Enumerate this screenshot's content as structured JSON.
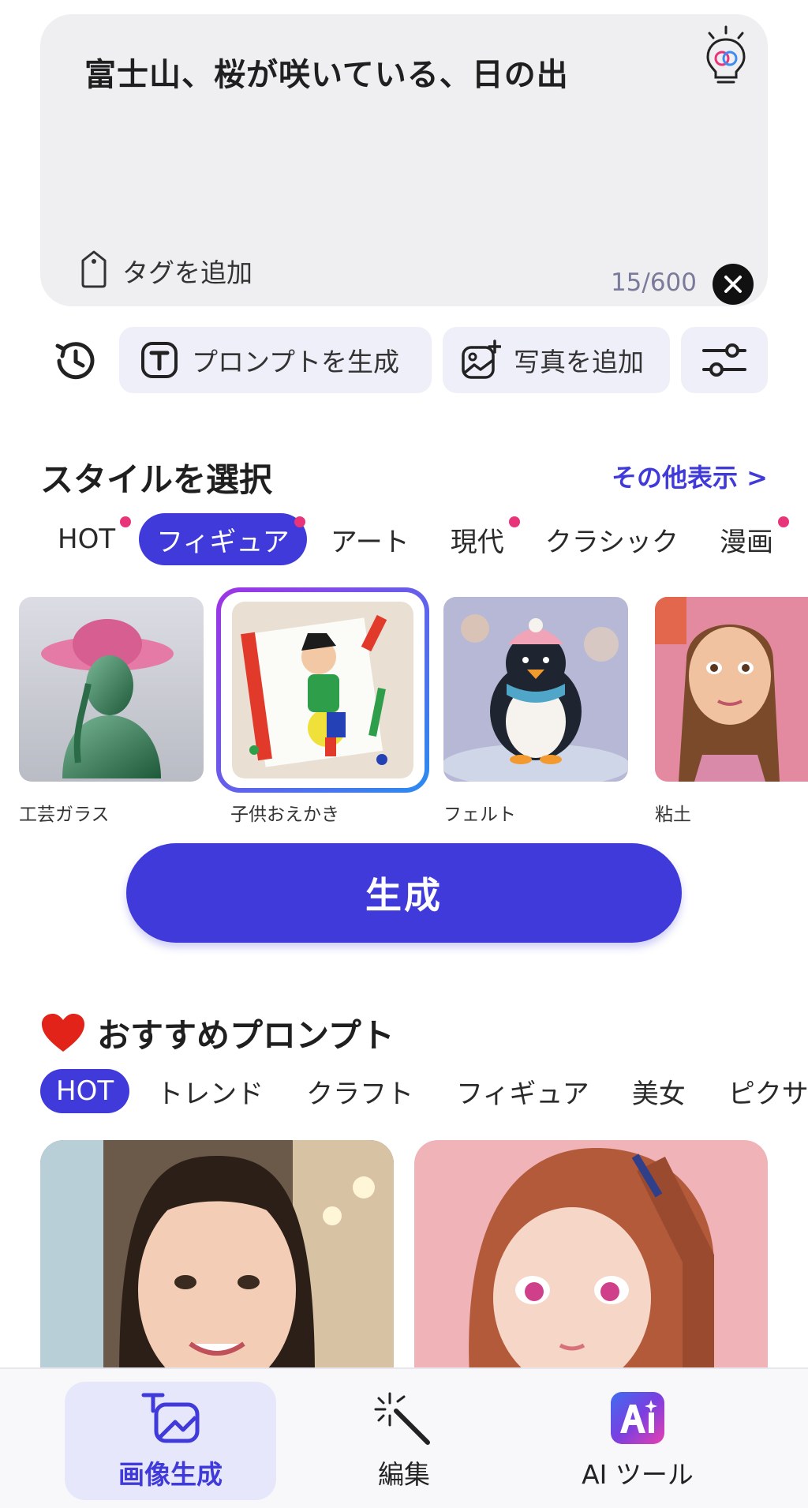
{
  "prompt": {
    "text": "富士山、桜が咲いている、日の出",
    "tag_label": "タグを追加",
    "counter": "15/600"
  },
  "actions": {
    "generate_prompt": "プロンプトを生成",
    "add_photo": "写真を追加"
  },
  "style_section": {
    "title": "スタイルを選択",
    "more": "その他表示 >",
    "tabs": [
      {
        "label": "HOT",
        "dot": true
      },
      {
        "label": "フィギュア",
        "dot": true,
        "active": true
      },
      {
        "label": "アート",
        "dot": false
      },
      {
        "label": "現代",
        "dot": true
      },
      {
        "label": "クラシック",
        "dot": false
      },
      {
        "label": "漫画",
        "dot": true
      }
    ],
    "thumbnails": [
      {
        "label": "工芸ガラス"
      },
      {
        "label": "子供おえかき",
        "selected": true
      },
      {
        "label": "フェルト"
      },
      {
        "label": "粘土"
      }
    ]
  },
  "generate_button": "生成",
  "recommended": {
    "icon": "heart-icon",
    "title": "おすすめプロンプト",
    "tabs": [
      "HOT",
      "トレンド",
      "クラフト",
      "フィギュア",
      "美女",
      "ピクサ"
    ]
  },
  "bottom_nav": {
    "items": [
      {
        "label": "画像生成",
        "icon": "image-generate-icon",
        "active": true
      },
      {
        "label": "編集",
        "icon": "magic-wand-icon"
      },
      {
        "label": "AI ツール",
        "icon": "ai-tools-icon"
      }
    ]
  },
  "colors": {
    "accent": "#3f3ad9",
    "badge_dot": "#e8357a",
    "prompt_bg": "#efeff1"
  }
}
